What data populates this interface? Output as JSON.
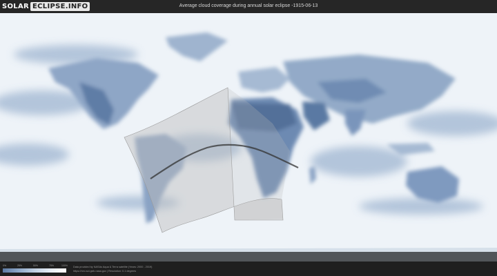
{
  "header": {
    "logo_left": "SOLAR",
    "logo_right": "ECLIPSE.INFO",
    "title": "Average cloud coverage during annual solar eclipse -1915-06-13"
  },
  "legend": {
    "ticks": [
      "0%",
      "25%",
      "50%",
      "75%",
      "100%"
    ],
    "gradient_colors": [
      "#5d7aa3",
      "#8ea8c8",
      "#c0d0e2",
      "#e6edf5",
      "#ffffff"
    ]
  },
  "footer": {
    "credit_line1": "Data provided by NASAs Aqua & Terra satellite (Years: 2000 - 2019)",
    "credit_line2": "https://neo.sci.gsfc.nasa.gov  |  Resolution: 0.1 degrees"
  },
  "colors": {
    "ocean_clear": "#5f80aa",
    "cloud": "#f2f6fa",
    "eclipse_zone": "#bdbdbd",
    "central_line": "#333333"
  }
}
